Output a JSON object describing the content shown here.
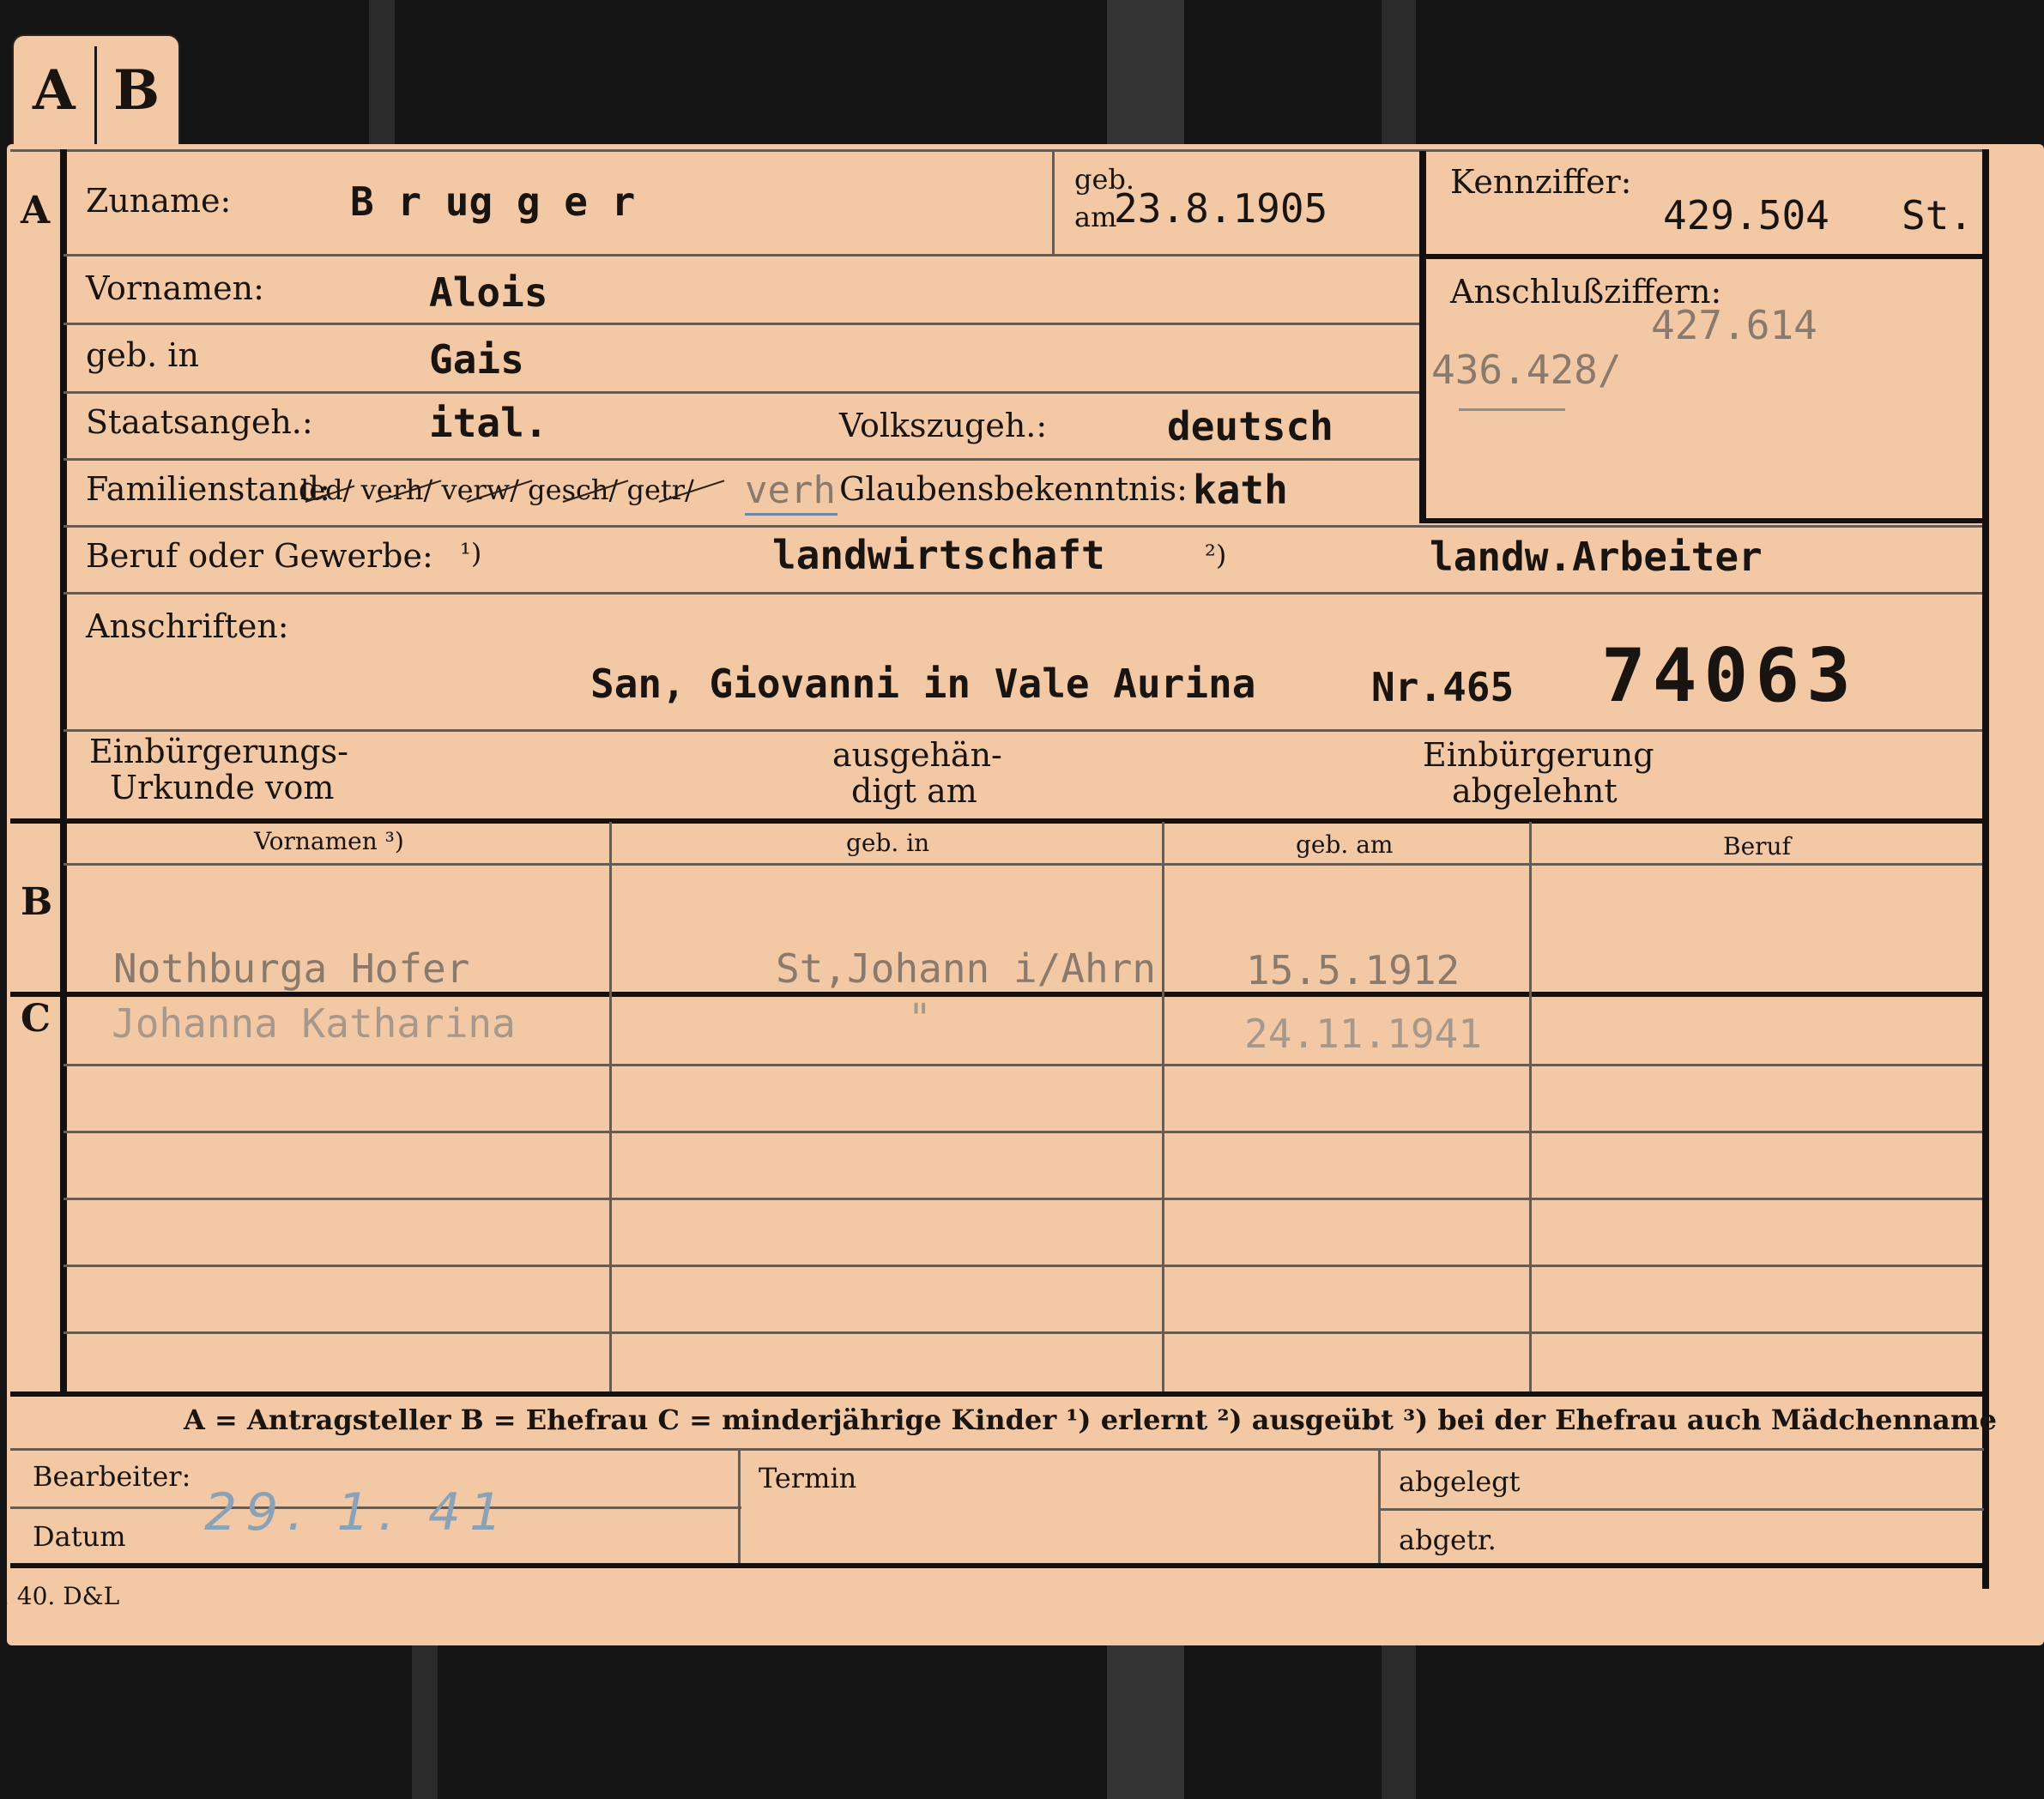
{
  "tab_letters": [
    "A",
    "B"
  ],
  "sections": {
    "a": "A",
    "b": "B",
    "c": "C"
  },
  "section_a": {
    "surname_label": "Zuname:",
    "surname_value": "B r ug g e r",
    "born_on_label_1": "geb.",
    "born_on_label_2": "am",
    "born_on_value": "23.8.1905",
    "first_names_label": "Vornamen:",
    "first_names_value": "Alois",
    "born_in_label": "geb. in",
    "born_in_value": "Gais",
    "citizenship_label": "Staatsangeh.:",
    "citizenship_value": "ital.",
    "ethnicity_label": "Volkszugeh.:",
    "ethnicity_value": "deutsch",
    "marital_label": "Familienstand:",
    "marital_options_struck": "led/ verh/ verw/ gesch/ getr/",
    "marital_value": "verh",
    "religion_label": "Glaubensbekenntnis:",
    "religion_value": "kath",
    "occupation_label": "Beruf oder Gewerbe:",
    "occupation_note_1": "¹)",
    "occupation_value_1": "landwirtschaft",
    "occupation_note_2": "²)",
    "occupation_value_2": "landw.Arbeiter",
    "address_label": "Anschriften:",
    "address_value": "San, Giovanni in Vale Aurina",
    "address_number": "Nr.465",
    "file_number": "74063",
    "naturalization_doc_label_1": "Einbürgerungs-",
    "naturalization_doc_label_2": "Urkunde vom",
    "issued_label_1": "ausgehän-",
    "issued_label_2": "digt am",
    "rejected_label_1": "Einbürgerung",
    "rejected_label_2": "abgelehnt"
  },
  "id_box": {
    "kennziffer_label": "Kennziffer:",
    "kennziffer_value": "429.504",
    "kennziffer_suffix": "St.",
    "anschluss_label": "Anschlußziffern:",
    "anschluss_value_1": "427.614",
    "anschluss_value_2": "436.428/"
  },
  "family_table": {
    "headers": [
      "Vornamen ³)",
      "geb. in",
      "geb. am",
      "Beruf"
    ],
    "spouse": {
      "name": "Nothburga Hofer",
      "born_in": "St,Johann i/Ahrn",
      "born_on": "15.5.1912",
      "job": ""
    },
    "children": [
      {
        "name": "Johanna Katharina",
        "born_in": "\"",
        "born_on": "24.11.1941",
        "job": ""
      }
    ]
  },
  "legend": "A = Antragsteller   B = Ehefrau   C = minderjährige Kinder   ¹) erlernt   ²) ausgeübt   ³) bei der Ehefrau auch Mädchenname",
  "footer": {
    "clerk_label": "Bearbeiter:",
    "date_label": "Datum",
    "date_value": "29. 1. 41",
    "deadline_label": "Termin",
    "filed_label": "abgelegt",
    "removed_label": "abgetr."
  },
  "print_mark": ". 40. D&L"
}
